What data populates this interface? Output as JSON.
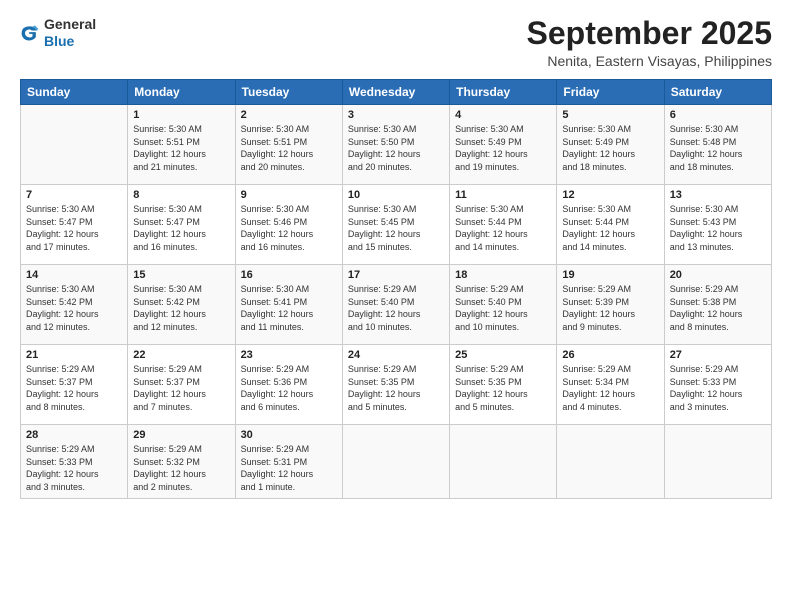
{
  "logo": {
    "general": "General",
    "blue": "Blue"
  },
  "header": {
    "month": "September 2025",
    "location": "Nenita, Eastern Visayas, Philippines"
  },
  "weekdays": [
    "Sunday",
    "Monday",
    "Tuesday",
    "Wednesday",
    "Thursday",
    "Friday",
    "Saturday"
  ],
  "weeks": [
    [
      {
        "day": "",
        "info": ""
      },
      {
        "day": "1",
        "info": "Sunrise: 5:30 AM\nSunset: 5:51 PM\nDaylight: 12 hours\nand 21 minutes."
      },
      {
        "day": "2",
        "info": "Sunrise: 5:30 AM\nSunset: 5:51 PM\nDaylight: 12 hours\nand 20 minutes."
      },
      {
        "day": "3",
        "info": "Sunrise: 5:30 AM\nSunset: 5:50 PM\nDaylight: 12 hours\nand 20 minutes."
      },
      {
        "day": "4",
        "info": "Sunrise: 5:30 AM\nSunset: 5:49 PM\nDaylight: 12 hours\nand 19 minutes."
      },
      {
        "day": "5",
        "info": "Sunrise: 5:30 AM\nSunset: 5:49 PM\nDaylight: 12 hours\nand 18 minutes."
      },
      {
        "day": "6",
        "info": "Sunrise: 5:30 AM\nSunset: 5:48 PM\nDaylight: 12 hours\nand 18 minutes."
      }
    ],
    [
      {
        "day": "7",
        "info": "Sunrise: 5:30 AM\nSunset: 5:47 PM\nDaylight: 12 hours\nand 17 minutes."
      },
      {
        "day": "8",
        "info": "Sunrise: 5:30 AM\nSunset: 5:47 PM\nDaylight: 12 hours\nand 16 minutes."
      },
      {
        "day": "9",
        "info": "Sunrise: 5:30 AM\nSunset: 5:46 PM\nDaylight: 12 hours\nand 16 minutes."
      },
      {
        "day": "10",
        "info": "Sunrise: 5:30 AM\nSunset: 5:45 PM\nDaylight: 12 hours\nand 15 minutes."
      },
      {
        "day": "11",
        "info": "Sunrise: 5:30 AM\nSunset: 5:44 PM\nDaylight: 12 hours\nand 14 minutes."
      },
      {
        "day": "12",
        "info": "Sunrise: 5:30 AM\nSunset: 5:44 PM\nDaylight: 12 hours\nand 14 minutes."
      },
      {
        "day": "13",
        "info": "Sunrise: 5:30 AM\nSunset: 5:43 PM\nDaylight: 12 hours\nand 13 minutes."
      }
    ],
    [
      {
        "day": "14",
        "info": "Sunrise: 5:30 AM\nSunset: 5:42 PM\nDaylight: 12 hours\nand 12 minutes."
      },
      {
        "day": "15",
        "info": "Sunrise: 5:30 AM\nSunset: 5:42 PM\nDaylight: 12 hours\nand 12 minutes."
      },
      {
        "day": "16",
        "info": "Sunrise: 5:30 AM\nSunset: 5:41 PM\nDaylight: 12 hours\nand 11 minutes."
      },
      {
        "day": "17",
        "info": "Sunrise: 5:29 AM\nSunset: 5:40 PM\nDaylight: 12 hours\nand 10 minutes."
      },
      {
        "day": "18",
        "info": "Sunrise: 5:29 AM\nSunset: 5:40 PM\nDaylight: 12 hours\nand 10 minutes."
      },
      {
        "day": "19",
        "info": "Sunrise: 5:29 AM\nSunset: 5:39 PM\nDaylight: 12 hours\nand 9 minutes."
      },
      {
        "day": "20",
        "info": "Sunrise: 5:29 AM\nSunset: 5:38 PM\nDaylight: 12 hours\nand 8 minutes."
      }
    ],
    [
      {
        "day": "21",
        "info": "Sunrise: 5:29 AM\nSunset: 5:37 PM\nDaylight: 12 hours\nand 8 minutes."
      },
      {
        "day": "22",
        "info": "Sunrise: 5:29 AM\nSunset: 5:37 PM\nDaylight: 12 hours\nand 7 minutes."
      },
      {
        "day": "23",
        "info": "Sunrise: 5:29 AM\nSunset: 5:36 PM\nDaylight: 12 hours\nand 6 minutes."
      },
      {
        "day": "24",
        "info": "Sunrise: 5:29 AM\nSunset: 5:35 PM\nDaylight: 12 hours\nand 5 minutes."
      },
      {
        "day": "25",
        "info": "Sunrise: 5:29 AM\nSunset: 5:35 PM\nDaylight: 12 hours\nand 5 minutes."
      },
      {
        "day": "26",
        "info": "Sunrise: 5:29 AM\nSunset: 5:34 PM\nDaylight: 12 hours\nand 4 minutes."
      },
      {
        "day": "27",
        "info": "Sunrise: 5:29 AM\nSunset: 5:33 PM\nDaylight: 12 hours\nand 3 minutes."
      }
    ],
    [
      {
        "day": "28",
        "info": "Sunrise: 5:29 AM\nSunset: 5:33 PM\nDaylight: 12 hours\nand 3 minutes."
      },
      {
        "day": "29",
        "info": "Sunrise: 5:29 AM\nSunset: 5:32 PM\nDaylight: 12 hours\nand 2 minutes."
      },
      {
        "day": "30",
        "info": "Sunrise: 5:29 AM\nSunset: 5:31 PM\nDaylight: 12 hours\nand 1 minute."
      },
      {
        "day": "",
        "info": ""
      },
      {
        "day": "",
        "info": ""
      },
      {
        "day": "",
        "info": ""
      },
      {
        "day": "",
        "info": ""
      }
    ]
  ]
}
